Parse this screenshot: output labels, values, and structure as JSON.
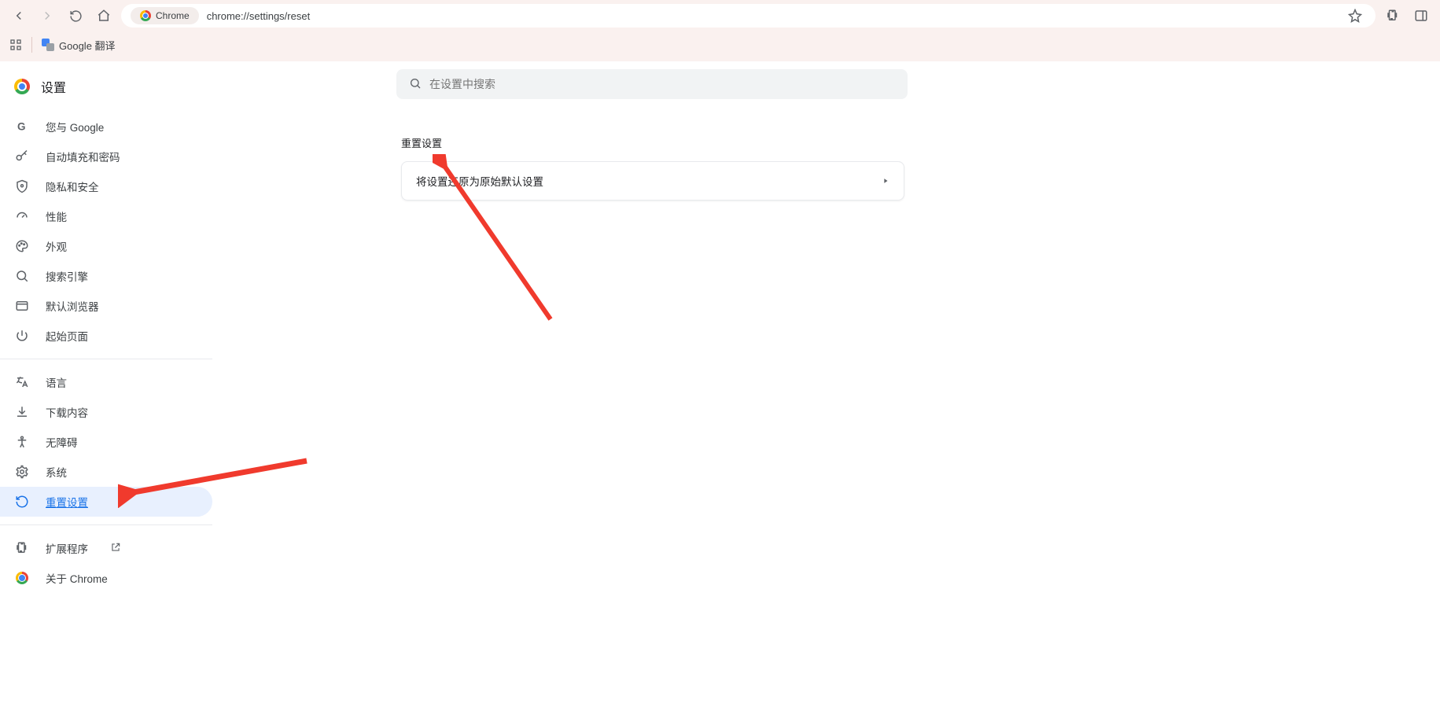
{
  "browser": {
    "chip_label": "Chrome",
    "url": "chrome://settings/reset"
  },
  "bookmarks": {
    "translate_label": "Google 翻译"
  },
  "sidebar": {
    "title": "设置",
    "groups": [
      {
        "items": [
          {
            "key": "you-and-google",
            "label": "您与 Google",
            "icon": "g"
          },
          {
            "key": "autofill-passwords",
            "label": "自动填充和密码",
            "icon": "key"
          },
          {
            "key": "privacy-security",
            "label": "隐私和安全",
            "icon": "shield"
          },
          {
            "key": "performance",
            "label": "性能",
            "icon": "speed"
          },
          {
            "key": "appearance",
            "label": "外观",
            "icon": "palette"
          },
          {
            "key": "search-engine",
            "label": "搜索引擎",
            "icon": "search"
          },
          {
            "key": "default-browser",
            "label": "默认浏览器",
            "icon": "window"
          },
          {
            "key": "on-startup",
            "label": "起始页面",
            "icon": "power"
          }
        ]
      },
      {
        "items": [
          {
            "key": "languages",
            "label": "语言",
            "icon": "lang"
          },
          {
            "key": "downloads",
            "label": "下载内容",
            "icon": "download"
          },
          {
            "key": "accessibility",
            "label": "无障碍",
            "icon": "a11y"
          },
          {
            "key": "system",
            "label": "系统",
            "icon": "gear"
          },
          {
            "key": "reset",
            "label": "重置设置",
            "icon": "reset",
            "selected": true
          }
        ]
      },
      {
        "items": [
          {
            "key": "extensions",
            "label": "扩展程序",
            "icon": "ext",
            "external": true
          },
          {
            "key": "about-chrome",
            "label": "关于 Chrome",
            "icon": "chrome"
          }
        ]
      }
    ]
  },
  "search": {
    "placeholder": "在设置中搜索"
  },
  "main": {
    "section_title": "重置设置",
    "reset_row_label": "将设置还原为原始默认设置"
  }
}
